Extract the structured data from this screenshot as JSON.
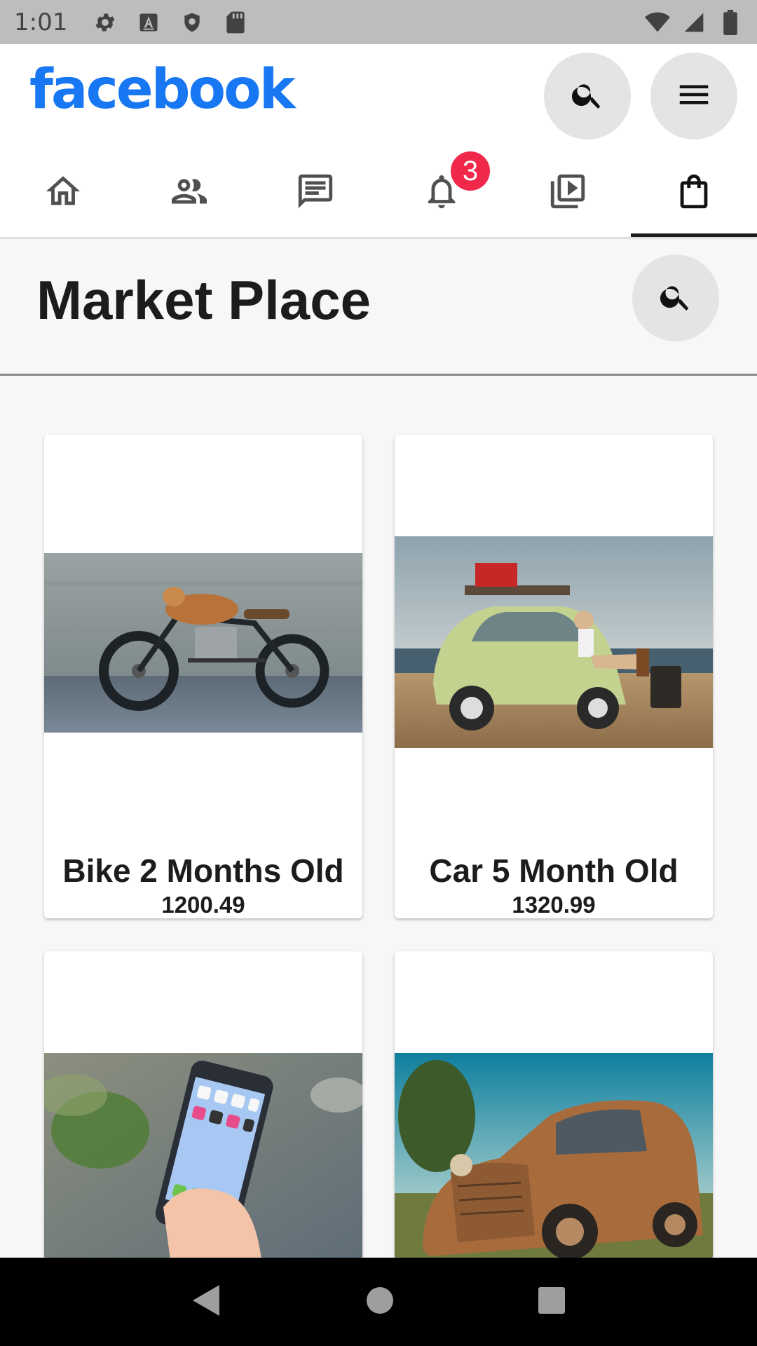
{
  "status_bar": {
    "time": "1:01",
    "left_icons": [
      "settings-icon",
      "font-a-icon",
      "shield-icon",
      "sd-card-icon"
    ],
    "right_icons": [
      "wifi-icon",
      "signal-icon",
      "battery-icon"
    ]
  },
  "header": {
    "logo": "facebook",
    "brand_color": "#1877f2",
    "actions": [
      "search-icon",
      "menu-icon"
    ],
    "tabs": [
      {
        "name": "home",
        "icon": "home-icon"
      },
      {
        "name": "friends",
        "icon": "friends-icon"
      },
      {
        "name": "messages",
        "icon": "message-icon"
      },
      {
        "name": "notifications",
        "icon": "bell-icon",
        "badge": "3"
      },
      {
        "name": "watch",
        "icon": "video-library-icon"
      },
      {
        "name": "marketplace",
        "icon": "shopping-bag-icon",
        "active": true
      }
    ],
    "badge_color": "#f02849"
  },
  "marketplace": {
    "title": "Market Place",
    "products": [
      {
        "title": "Bike 2 Months Old",
        "price": "1200.49",
        "image": "motorcycle-photo"
      },
      {
        "title": "Car 5 Month Old",
        "price": "1320.99",
        "image": "vintage-car-photo"
      },
      {
        "title": "",
        "price": "",
        "image": "smartphone-photo"
      },
      {
        "title": "",
        "price": "",
        "image": "rusty-truck-photo"
      }
    ]
  },
  "system_nav": [
    "back-icon",
    "home-circle-icon",
    "recents-icon"
  ]
}
